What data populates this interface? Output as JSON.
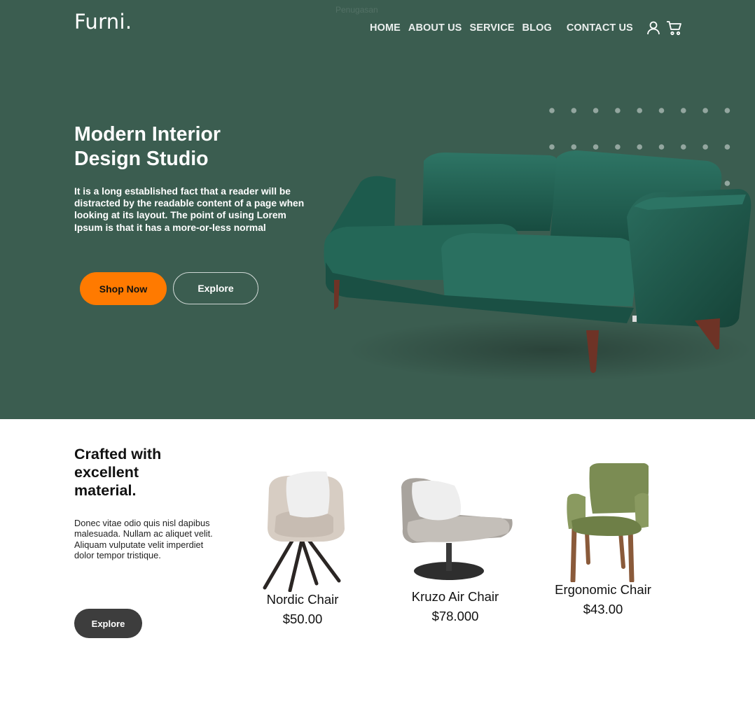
{
  "header": {
    "brand": "Furni.",
    "faint_label": "Penugasan",
    "nav": [
      "HOME",
      "ABOUT US",
      "SERVICE",
      "BLOG",
      "CONTACT US"
    ]
  },
  "hero": {
    "title_line1": "Modern Interior",
    "title_line2": "Design Studio",
    "description": "It is a long established fact that a reader will be distracted by the readable content of a page when looking at its layout. The point of using Lorem Ipsum is that it has a more-or-less normal",
    "shop_label": "Shop Now",
    "explore_label": "Explore"
  },
  "products_section": {
    "title_line1": "Crafted with",
    "title_line2": "excellent",
    "title_line3": "material.",
    "description": "Donec vitae odio quis nisl dapibus malesuada. Nullam ac aliquet velit. Aliquam vulputate velit imperdiet dolor tempor tristique.",
    "explore_label": "Explore",
    "items": [
      {
        "name": "Nordic Chair",
        "price": "$50.00"
      },
      {
        "name": "Kruzo Air Chair",
        "price": "$78.000"
      },
      {
        "name": "Ergonomic Chair",
        "price": "$43.00"
      }
    ]
  },
  "icons": [
    "user-icon",
    "cart-icon"
  ],
  "colors": {
    "hero_bg": "#3b5d50",
    "accent_orange": "#ff7a00",
    "dark_button": "#3d3d3d",
    "sofa_green": "#1f5a4c"
  }
}
